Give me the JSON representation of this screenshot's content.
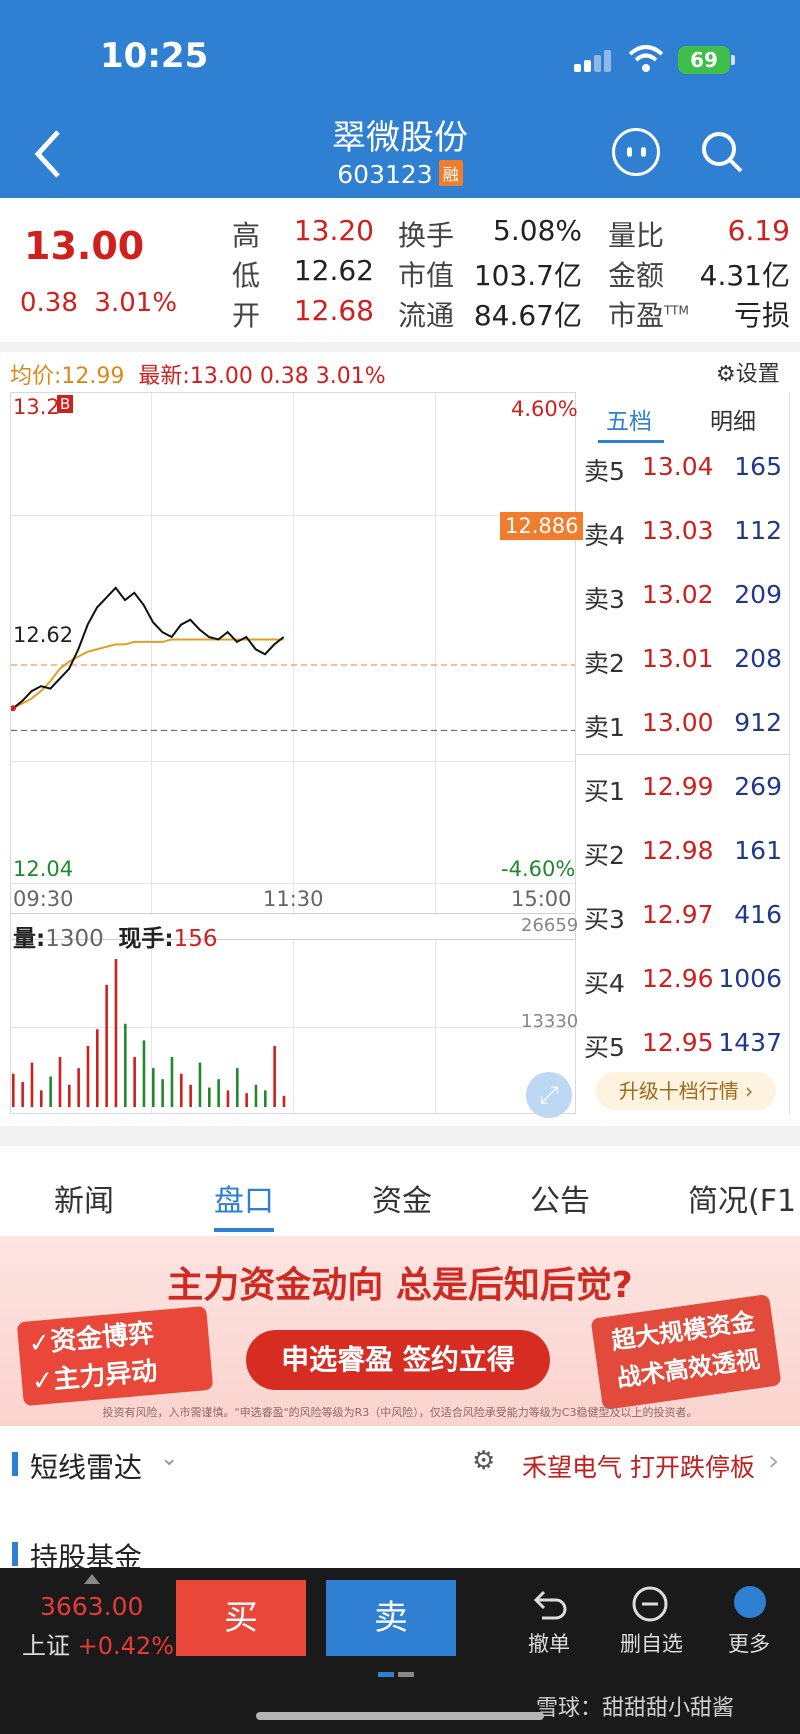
{
  "status_bar": {
    "time": "10:25",
    "battery": "69"
  },
  "header": {
    "name": "翠微股份",
    "code": "603123",
    "margin_tag": "融"
  },
  "quote": {
    "price": "13.00",
    "change": "0.38",
    "change_pct": "3.01%",
    "stats": [
      {
        "label": "高",
        "value": "13.20"
      },
      {
        "label": "换手",
        "value": "5.08%"
      },
      {
        "label": "量比",
        "value": "6.19"
      },
      {
        "label": "低",
        "value": "12.62"
      },
      {
        "label": "市值",
        "value": "103.7亿"
      },
      {
        "label": "金额",
        "value": "4.31亿"
      },
      {
        "label": "开",
        "value": "12.68"
      },
      {
        "label": "流通",
        "value": "84.67亿"
      },
      {
        "label": "市盈",
        "value": "亏损",
        "sup": "TTM"
      }
    ]
  },
  "chart_header": {
    "avg_label": "均价:",
    "avg_value": "12.99",
    "latest_label": "最新:",
    "latest_value": "13.00",
    "latest_change": "0.38",
    "latest_pct": "3.01%",
    "settings_label": "设置"
  },
  "chart_labels": {
    "high": "13.2",
    "b_marker": "B",
    "max_pct": "4.60%",
    "ref_price": "12.886",
    "low_line": "12.62",
    "min_price": "12.04",
    "min_pct": "-4.60%",
    "t_open": "09:30",
    "t_mid": "11:30",
    "t_close": "15:00",
    "vol_label": "量:",
    "vol_value": "1300",
    "cur_label": "现手:",
    "cur_value": "156",
    "vol_max": "26659",
    "vol_mid": "13330"
  },
  "chart_data": {
    "type": "line",
    "x_range": [
      "09:30",
      "15:00"
    ],
    "ylim": [
      12.04,
      13.96
    ],
    "series": [],
    "price": [
      12.71,
      12.74,
      12.78,
      12.8,
      12.79,
      12.83,
      12.87,
      12.95,
      13.05,
      13.12,
      13.16,
      13.2,
      13.15,
      13.18,
      13.13,
      13.06,
      13.02,
      13.0,
      13.05,
      13.07,
      13.03,
      13.0,
      12.99,
      13.02,
      12.98,
      13.0,
      12.95,
      12.93,
      12.97,
      13.0
    ],
    "avg": [
      12.71,
      12.73,
      12.75,
      12.78,
      12.82,
      12.87,
      12.9,
      12.92,
      12.94,
      12.95,
      12.96,
      12.97,
      12.97,
      12.98,
      12.98,
      12.98,
      12.98,
      12.99,
      12.99,
      12.99,
      12.99,
      12.99,
      12.99,
      12.99,
      12.99,
      12.99,
      12.99,
      12.99,
      12.99,
      12.99
    ],
    "volume_max": 26659,
    "volume": [
      6000,
      4500,
      8000,
      3000,
      5500,
      9000,
      4000,
      7000,
      11000,
      14000,
      22000,
      26659,
      15000,
      9000,
      12000,
      7000,
      5000,
      9000,
      6000,
      4000,
      8000,
      3500,
      5000,
      3000,
      7000,
      2500,
      4000,
      3000,
      11000,
      2000
    ]
  },
  "order_book": {
    "tab_active": "五档",
    "tab_other": "明细",
    "asks": [
      {
        "label": "卖5",
        "price": "13.04",
        "vol": "165"
      },
      {
        "label": "卖4",
        "price": "13.03",
        "vol": "112"
      },
      {
        "label": "卖3",
        "price": "13.02",
        "vol": "209"
      },
      {
        "label": "卖2",
        "price": "13.01",
        "vol": "208"
      },
      {
        "label": "卖1",
        "price": "13.00",
        "vol": "912"
      }
    ],
    "bids": [
      {
        "label": "买1",
        "price": "12.99",
        "vol": "269"
      },
      {
        "label": "买2",
        "price": "12.98",
        "vol": "161"
      },
      {
        "label": "买3",
        "price": "12.97",
        "vol": "416"
      },
      {
        "label": "买4",
        "price": "12.96",
        "vol": "1006"
      },
      {
        "label": "买5",
        "price": "12.95",
        "vol": "1437"
      }
    ],
    "upgrade_label": "升级十档行情 ›"
  },
  "tabs": [
    "新闻",
    "盘口",
    "资金",
    "公告",
    "简况(F1"
  ],
  "banner": {
    "title": "主力资金动向 总是后知后觉?",
    "left_line1": "✓资金博弈",
    "left_line2": "✓主力异动",
    "cta": "申选睿盈 签约立得",
    "right_line1": "超大规模资金",
    "right_line2": "战术高效透视",
    "disclaimer": "投资有风险，入市需谨慎。\"申选睿盈\"的风险等级为R3（中风险），仅适合风险承受能力等级为C3稳健型及以上的投资者。"
  },
  "radar": {
    "title": "短线雷达",
    "message": "禾望电气 打开跌停板"
  },
  "fund_section": {
    "title": "持股基金"
  },
  "bottom_bar": {
    "index_value": "3663.00",
    "index_name": "上证",
    "index_pct": "+0.42%",
    "buy": "买",
    "sell": "卖",
    "cancel": "撤单",
    "remove_fav": "删自选",
    "more": "更多"
  },
  "watermark": "雪球：甜甜甜小甜酱"
}
